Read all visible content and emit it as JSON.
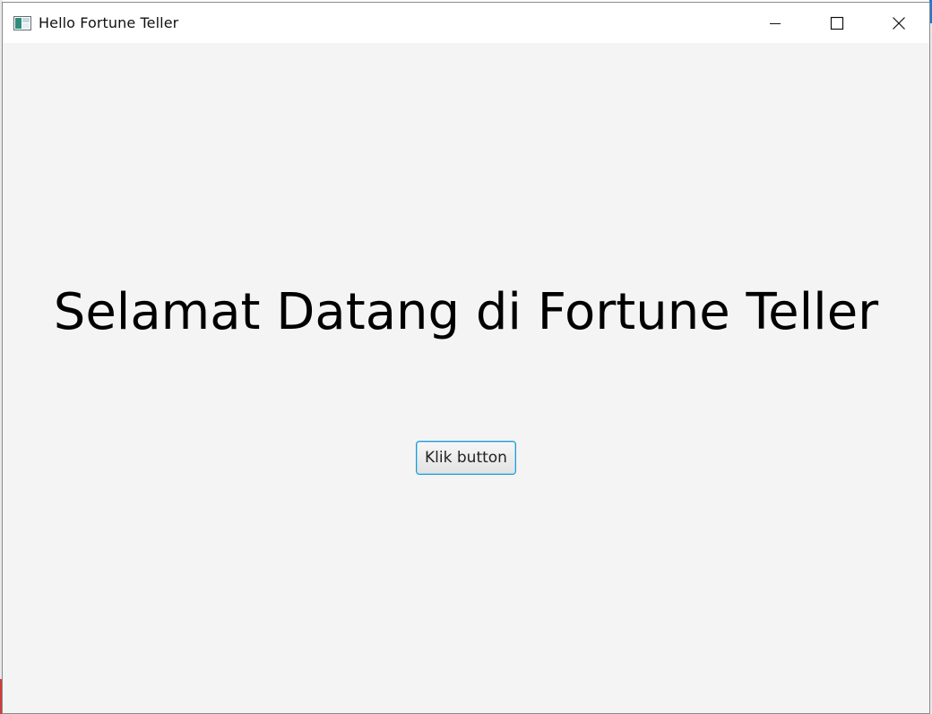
{
  "window": {
    "title": "Hello Fortune Teller",
    "controls": {
      "minimize_icon": "minimize-icon",
      "maximize_icon": "maximize-icon",
      "close_icon": "close-icon"
    }
  },
  "main": {
    "heading": "Selamat Datang di Fortune Teller",
    "button_label": "Klik button"
  },
  "colors": {
    "content_background": "#f4f4f4",
    "titlebar_background": "#ffffff",
    "button_focus_border": "#1e9bd6",
    "text": "#000000"
  }
}
